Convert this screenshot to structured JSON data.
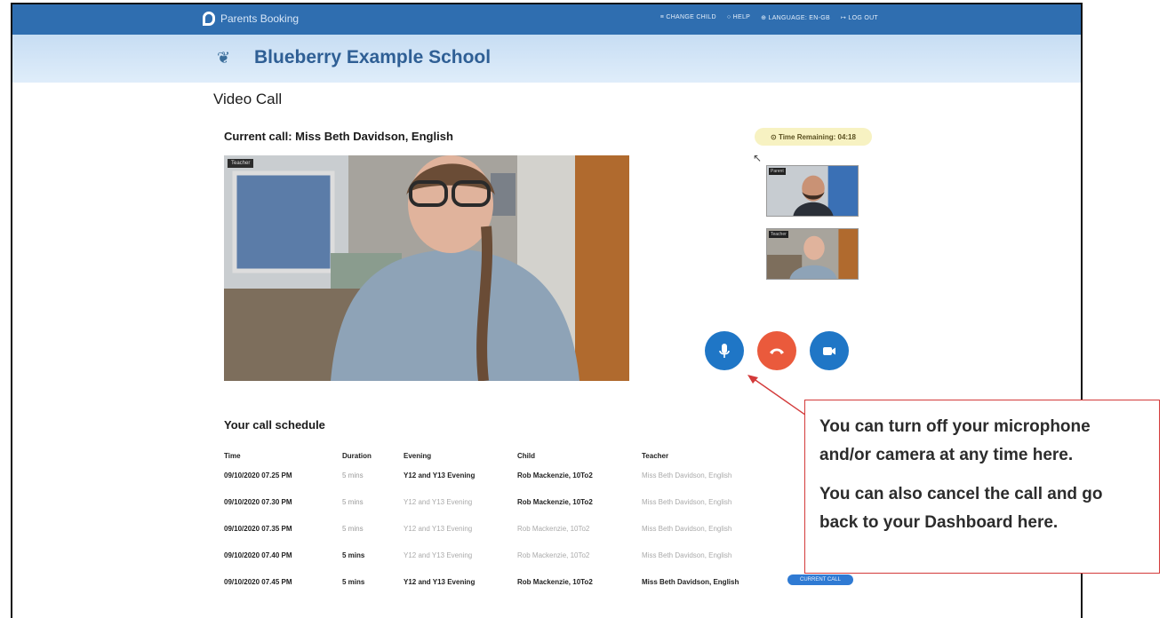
{
  "header": {
    "brand": "Parents Booking",
    "nav": [
      "≡ CHANGE CHILD",
      "○ HELP",
      "⊕ LANGUAGE: EN-GB",
      "↦ LOG OUT"
    ]
  },
  "school": {
    "name": "Blueberry Example School"
  },
  "page": {
    "title": "Video Call",
    "current_call": "Current call: Miss Beth Davidson, English"
  },
  "video": {
    "main_tag": "Teacher",
    "thumb1_tag": "Parent",
    "thumb2_tag": "Teacher"
  },
  "timer": {
    "label": "⊙ Time Remaining: 04:18"
  },
  "controls": {
    "mic_icon": "microphone-icon",
    "hangup_icon": "phone-hangup-icon",
    "camera_icon": "camera-icon",
    "colors": {
      "mic": "#1f76c6",
      "hangup": "#ea5a3c",
      "camera": "#1f76c6"
    }
  },
  "schedule": {
    "title": "Your call schedule",
    "columns": [
      "Time",
      "Duration",
      "Evening",
      "Child",
      "Teacher"
    ],
    "rows": [
      [
        "09/10/2020 07.25 PM",
        "5 mins",
        "Y12 and Y13 Evening",
        "Rob Mackenzie, 10To2",
        "Miss Beth Davidson, English"
      ],
      [
        "09/10/2020 07.30 PM",
        "5 mins",
        "Y12 and Y13 Evening",
        "Rob Mackenzie, 10To2",
        "Miss Beth Davidson, English"
      ],
      [
        "09/10/2020 07.35 PM",
        "5 mins",
        "Y12 and Y13 Evening",
        "Rob Mackenzie, 10To2",
        "Miss Beth Davidson, English"
      ],
      [
        "09/10/2020 07.40 PM",
        "5 mins",
        "Y12 and Y13 Evening",
        "Rob Mackenzie, 10To2",
        "Miss Beth Davidson, English"
      ],
      [
        "09/10/2020 07.45 PM",
        "5 mins",
        "Y12 and Y13 Evening",
        "Rob Mackenzie, 10To2",
        "Miss Beth Davidson, English"
      ]
    ],
    "current_label": "CURRENT CALL"
  },
  "callout": {
    "line1": "You can turn off your microphone and/or camera at any time here.",
    "line2": "You can also cancel the call and go back to your Dashboard here."
  }
}
